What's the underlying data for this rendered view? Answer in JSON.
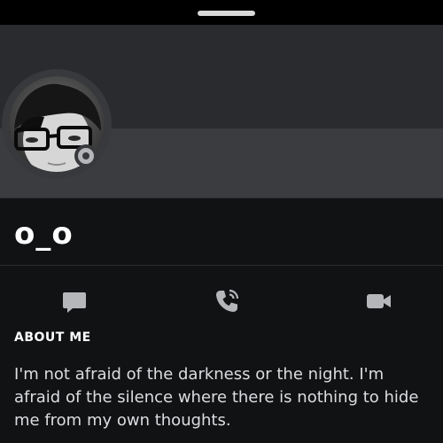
{
  "sheet": {
    "handle_color": "#d8d8d8"
  },
  "profile": {
    "display_name": "o_o",
    "avatar_icon": "avatar-photo",
    "status_icon": "idle-status-icon",
    "banner_color": "#2a2b2e"
  },
  "actions": [
    {
      "icon": "message-icon"
    },
    {
      "icon": "voice-call-icon"
    },
    {
      "icon": "video-call-icon"
    }
  ],
  "about": {
    "heading": "ABOUT ME",
    "text": "I'm not afraid of the darkness or the night. I'm afraid of the silence where there is nothing to hide me from my own thoughts."
  },
  "colors": {
    "background": "#000000",
    "card": "#111214",
    "icon": "#b5b6ba",
    "text": "#dcdde0"
  }
}
